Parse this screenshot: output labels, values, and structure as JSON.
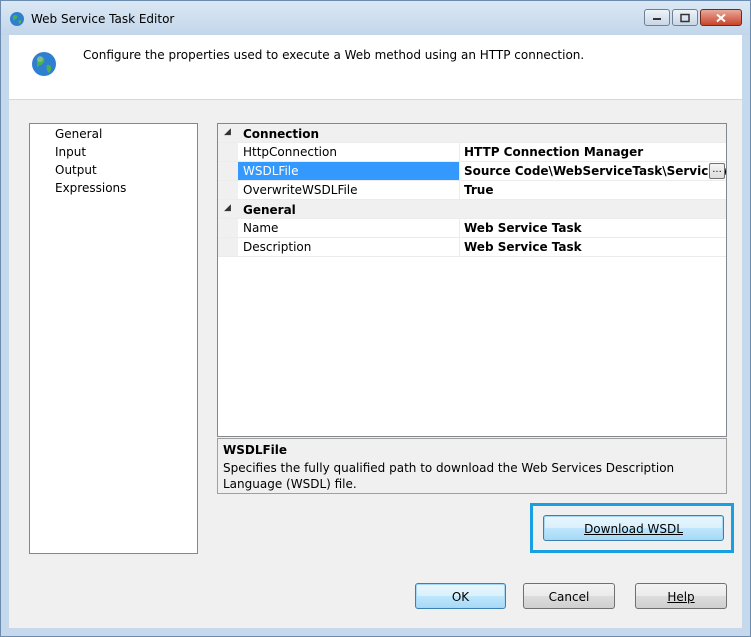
{
  "window": {
    "title": "Web Service Task Editor"
  },
  "header": {
    "description": "Configure the properties used to execute a Web method using an HTTP connection."
  },
  "nav": {
    "items": [
      {
        "label": "General"
      },
      {
        "label": "Input"
      },
      {
        "label": "Output"
      },
      {
        "label": "Expressions"
      }
    ]
  },
  "grid": {
    "categories": [
      {
        "label": "Connection",
        "properties": [
          {
            "name": "HttpConnection",
            "value": "HTTP Connection Manager"
          },
          {
            "name": "WSDLFile",
            "value": "Source Code\\WebServiceTask\\Service.wsdl"
          },
          {
            "name": "OverwriteWSDLFile",
            "value": "True"
          }
        ]
      },
      {
        "label": "General",
        "properties": [
          {
            "name": "Name",
            "value": "Web Service Task"
          },
          {
            "name": "Description",
            "value": "Web Service Task"
          }
        ]
      }
    ],
    "ellipsis": "..."
  },
  "description_panel": {
    "title": "WSDLFile",
    "text": "Specifies the fully qualified path to download the Web Services Description Language (WSDL) file."
  },
  "buttons": {
    "download_wsdl": "Download WSDL",
    "ok": "OK",
    "cancel": "Cancel",
    "help": "Help"
  },
  "colors": {
    "selection": "#3399ff",
    "highlight_border": "#1aa0e0"
  }
}
